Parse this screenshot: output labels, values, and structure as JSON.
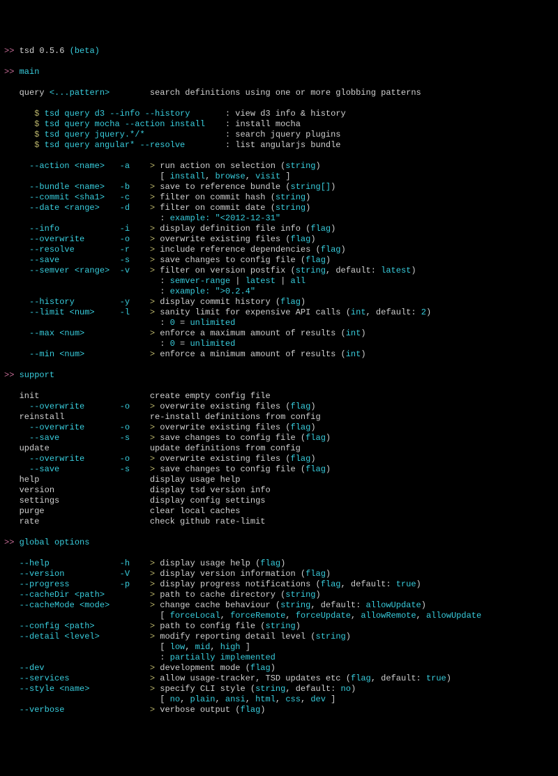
{
  "header": {
    "prompt": ">>",
    "name": "tsd",
    "version": "0.5.6",
    "beta": "(beta)"
  },
  "main": {
    "title": "main",
    "query": {
      "cmd": "query",
      "arg": "<...pattern>",
      "desc": "search definitions using one or more globbing patterns"
    },
    "examples": [
      {
        "dollar": "$",
        "cmd": "tsd query d3 --info --history",
        "desc": "view d3 info & history"
      },
      {
        "dollar": "$",
        "cmd": "tsd query mocha --action install",
        "desc": "install mocha"
      },
      {
        "dollar": "$",
        "cmd": "tsd query jquery.*/*",
        "desc": "search jquery plugins"
      },
      {
        "dollar": "$",
        "cmd": "tsd query angular* --resolve",
        "desc": "list angularjs bundle"
      }
    ],
    "opts": [
      {
        "long": "--action <name>",
        "short": "-a",
        "desc": [
          "run action on selection (",
          "string",
          ")"
        ],
        "detail": [
          "[ ",
          "install",
          ", ",
          "browse",
          ", ",
          "visit",
          " ]"
        ]
      },
      {
        "long": "--bundle <name>",
        "short": "-b",
        "desc": [
          "save to reference bundle (",
          "string[]",
          ")"
        ]
      },
      {
        "long": "--commit <sha1>",
        "short": "-c",
        "desc": [
          "filter on commit hash (",
          "string",
          ")"
        ]
      },
      {
        "long": "--date <range>",
        "short": "-d",
        "desc": [
          "filter on commit date (",
          "string",
          ")"
        ],
        "detail": [
          ": ",
          "example: \"<2012-12-31\""
        ]
      },
      {
        "long": "--info",
        "short": "-i",
        "desc": [
          "display definition file info (",
          "flag",
          ")"
        ]
      },
      {
        "long": "--overwrite",
        "short": "-o",
        "desc": [
          "overwrite existing files (",
          "flag",
          ")"
        ]
      },
      {
        "long": "--resolve",
        "short": "-r",
        "desc": [
          "include reference dependencies (",
          "flag",
          ")"
        ]
      },
      {
        "long": "--save",
        "short": "-s",
        "desc": [
          "save changes to config file (",
          "flag",
          ")"
        ]
      },
      {
        "long": "--semver <range>",
        "short": "-v",
        "desc": [
          "filter on version postfix (",
          "string",
          ", default: ",
          "latest",
          ")"
        ],
        "detail": [
          ": ",
          "semver-range",
          " | ",
          "latest",
          " | ",
          "all"
        ],
        "detail2": [
          ": ",
          "example: \">0.2.4\""
        ]
      },
      {
        "long": "--history",
        "short": "-y",
        "desc": [
          "display commit history (",
          "flag",
          ")"
        ]
      },
      {
        "long": "--limit <num>",
        "short": "-l",
        "desc": [
          "sanity limit for expensive API calls (",
          "int",
          ", default: ",
          "2",
          ")"
        ],
        "detail": [
          ": ",
          "0",
          " = ",
          "unlimited"
        ]
      },
      {
        "long": "--max <num>",
        "short": "",
        "desc": [
          "enforce a maximum amount of results (",
          "int",
          ")"
        ],
        "detail": [
          ": ",
          "0",
          " = ",
          "unlimited"
        ]
      },
      {
        "long": "--min <num>",
        "short": "",
        "desc": [
          "enforce a minimum amount of results (",
          "int",
          ")"
        ]
      }
    ]
  },
  "support": {
    "title": "support",
    "cmds": [
      {
        "cmd": "init",
        "desc": "create empty config file",
        "sub": [
          {
            "long": "--overwrite",
            "short": "-o",
            "desc": [
              "overwrite existing files (",
              "flag",
              ")"
            ],
            "indent": 1
          }
        ]
      },
      {
        "cmd": "reinstall",
        "desc": "re-install definitions from config",
        "sub": [
          {
            "long": "--overwrite",
            "short": "-o",
            "desc": [
              "overwrite existing files (",
              "flag",
              ")"
            ],
            "indent": 1
          },
          {
            "long": "--save",
            "short": "-s",
            "desc": [
              "save changes to config file (",
              "flag",
              ")"
            ],
            "indent": 1
          }
        ]
      },
      {
        "cmd": "update",
        "desc": "update definitions from config",
        "sub": [
          {
            "long": "--overwrite",
            "short": "-o",
            "desc": [
              "overwrite existing files (",
              "flag",
              ")"
            ],
            "indent": 1
          },
          {
            "long": "--save",
            "short": "-s",
            "desc": [
              "save changes to config file (",
              "flag",
              ")"
            ],
            "indent": 1
          }
        ]
      },
      {
        "cmd": "help",
        "desc": "display usage help"
      },
      {
        "cmd": "version",
        "desc": "display tsd version info"
      },
      {
        "cmd": "settings",
        "desc": "display config settings"
      },
      {
        "cmd": "purge",
        "desc": "clear local caches"
      },
      {
        "cmd": "rate",
        "desc": "check github rate-limit"
      }
    ]
  },
  "global": {
    "title": "global options",
    "opts": [
      {
        "long": "--help",
        "short": "-h",
        "desc": [
          "display usage help (",
          "flag",
          ")"
        ]
      },
      {
        "long": "--version",
        "short": "-V",
        "desc": [
          "display version information (",
          "flag",
          ")"
        ]
      },
      {
        "long": "--progress",
        "short": "-p",
        "desc": [
          "display progress notifications (",
          "flag",
          ", default: ",
          "true",
          ")"
        ]
      },
      {
        "long": "--cacheDir <path>",
        "short": "",
        "desc": [
          "path to cache directory (",
          "string",
          ")"
        ]
      },
      {
        "long": "--cacheMode <mode>",
        "short": "",
        "desc": [
          "change cache behaviour (",
          "string",
          ", default: ",
          "allowUpdate",
          ")"
        ],
        "detail": [
          "[ ",
          "forceLocal",
          ", ",
          "forceRemote",
          ", ",
          "forceUpdate",
          ", ",
          "allowRemote",
          ", ",
          "allowUpdate"
        ]
      },
      {
        "long": "--config <path>",
        "short": "",
        "desc": [
          "path to config file (",
          "string",
          ")"
        ]
      },
      {
        "long": "--detail <level>",
        "short": "",
        "desc": [
          "modify reporting detail level (",
          "string",
          ")"
        ],
        "detail": [
          "[ ",
          "low",
          ", ",
          "mid",
          ", ",
          "high",
          " ]"
        ],
        "detail2": [
          ": ",
          "partially implemented"
        ]
      },
      {
        "long": "--dev",
        "short": "",
        "desc": [
          "development mode (",
          "flag",
          ")"
        ]
      },
      {
        "long": "--services",
        "short": "",
        "desc": [
          "allow usage-tracker, TSD updates etc (",
          "flag",
          ", default: ",
          "true",
          ")"
        ]
      },
      {
        "long": "--style <name>",
        "short": "",
        "desc": [
          "specify CLI style (",
          "string",
          ", default: ",
          "no",
          ")"
        ],
        "detail": [
          "[ ",
          "no",
          ", ",
          "plain",
          ", ",
          "ansi",
          ", ",
          "html",
          ", ",
          "css",
          ", ",
          "dev",
          " ]"
        ]
      },
      {
        "long": "--verbose",
        "short": "",
        "desc": [
          "verbose output (",
          "flag",
          ")"
        ]
      }
    ]
  }
}
